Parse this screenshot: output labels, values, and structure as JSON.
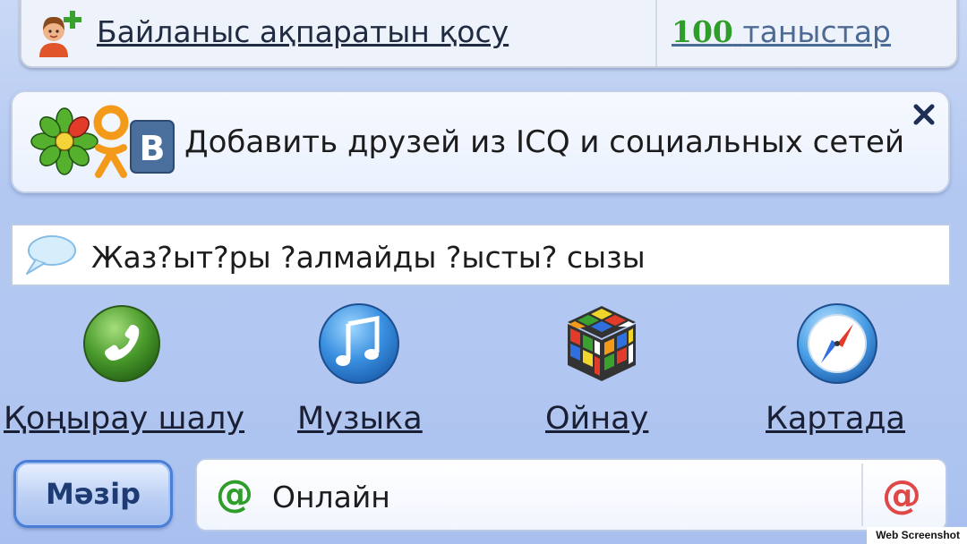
{
  "header": {
    "add_contact_label": "Байланыс ақпаратын қосу",
    "friends_count": "100",
    "friends_label": "таныстар",
    "icon": "add-contact-icon"
  },
  "social_banner": {
    "text": "Добавить друзей из ICQ и социальных сетей",
    "icons": [
      "icq-icon",
      "odnoklassniki-icon",
      "vk-icon"
    ],
    "close_icon": "close-icon"
  },
  "status_message": {
    "value": "Жаз?ыт?ры ?алмайды ?ысты? сызы",
    "icon": "speech-bubble-icon"
  },
  "actions": [
    {
      "label": "Қоңырау шалу",
      "icon": "phone-icon"
    },
    {
      "label": "Музыка",
      "icon": "music-note-icon"
    },
    {
      "label": "Ойнау",
      "icon": "rubiks-cube-icon"
    },
    {
      "label": "Картада",
      "icon": "compass-icon"
    }
  ],
  "footer": {
    "menu_label": "Мәзір",
    "status_label": "Онлайн",
    "status_icon": "online-at-icon",
    "mail_icon": "mail-at-icon"
  },
  "watermark": "Web Screenshot",
  "colors": {
    "background": "#b3c8f1",
    "friends_count": "#2f9d2a",
    "menu_border": "#4a7fd8",
    "online_green": "#2f9d2a",
    "mail_red": "#e04848"
  }
}
